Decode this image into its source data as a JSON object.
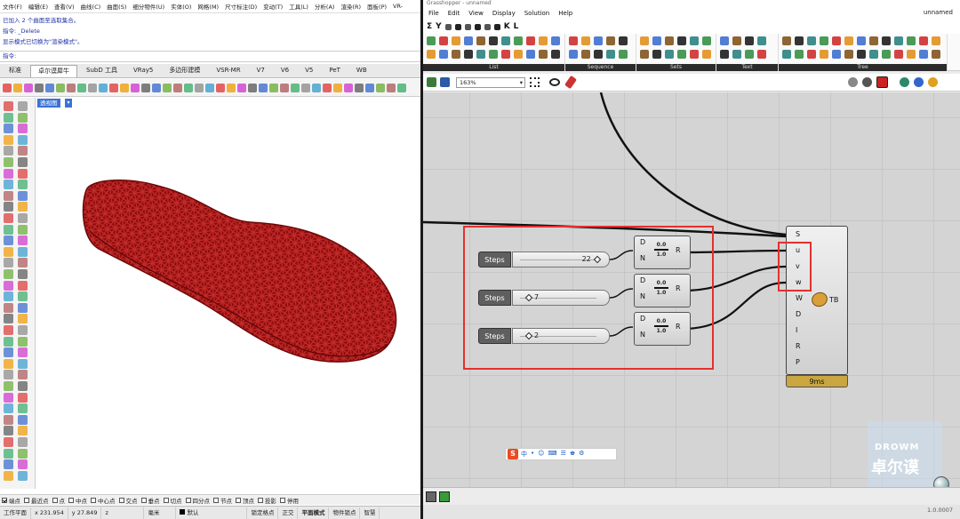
{
  "rhino": {
    "menu": [
      "文件(F)",
      "编辑(E)",
      "查看(V)",
      "曲线(C)",
      "曲面(S)",
      "细分物件(U)",
      "实体(O)",
      "网格(M)",
      "尺寸标注(D)",
      "变动(T)",
      "工具(L)",
      "分析(A)",
      "渲染(R)",
      "面板(P)",
      "VR-"
    ],
    "command_history": [
      "已加入 2 个曲面至选取集合。",
      "指令: _Delete",
      "显示模式已切换为\"渲染模式\"。"
    ],
    "command_prompt": "指令:",
    "tabs": [
      "标准",
      "卓尔谟犀牛",
      "SubD 工具",
      "VRay5",
      "多边形建模",
      "VSR-MR",
      "V7",
      "V6",
      "V5",
      "PeT",
      "WB"
    ],
    "active_tab": "卓尔谟犀牛",
    "viewport_label": "透视图",
    "viewport_arrow": "▾",
    "model_color": "#a01212",
    "osnaps": [
      {
        "label": "端点",
        "on": true
      },
      {
        "label": "最近点",
        "on": false
      },
      {
        "label": "点",
        "on": false
      },
      {
        "label": "中点",
        "on": false
      },
      {
        "label": "中心点",
        "on": false
      },
      {
        "label": "交点",
        "on": false
      },
      {
        "label": "垂点",
        "on": false
      },
      {
        "label": "切点",
        "on": false
      },
      {
        "label": "四分点",
        "on": false
      },
      {
        "label": "节点",
        "on": false
      },
      {
        "label": "顶点",
        "on": false
      },
      {
        "label": "投影",
        "on": false
      },
      {
        "label": "停用",
        "on": false
      }
    ],
    "status": {
      "cplane": "工作平面",
      "x": "x 231.954",
      "y": "y 27.849",
      "z": "z",
      "unit": "毫米",
      "layer": "默认",
      "items": [
        "锁定格点",
        "正交",
        "平面模式",
        "物件锁点",
        "智慧"
      ]
    }
  },
  "grasshopper": {
    "title": "Grasshopper - unnamed",
    "menu": [
      "File",
      "Edit",
      "View",
      "Display",
      "Solution",
      "Help"
    ],
    "doc_name": "unnamed",
    "icon_row": [
      "Σ",
      "Y",
      "K",
      "L"
    ],
    "ribbon_groups": [
      "List",
      "Sequence",
      "Sets",
      "Text",
      "Tree"
    ],
    "zoom": "163%",
    "sliders": [
      {
        "label": "Steps",
        "value": "22",
        "fraction": 0.95
      },
      {
        "label": "Steps",
        "value": "7",
        "fraction": 0.08
      },
      {
        "label": "Steps",
        "value": "2",
        "fraction": 0.08
      }
    ],
    "range_component": {
      "inputs": [
        "D",
        "N"
      ],
      "output": "R",
      "icon_top": "0.0",
      "icon_bottom": "1.0"
    },
    "tb_component": {
      "inputs": [
        "S",
        "u",
        "v",
        "w",
        "W",
        "D",
        "I",
        "R",
        "P"
      ],
      "output": "TB",
      "time": "9ms"
    },
    "ime": {
      "logo": "S",
      "items": [
        "中",
        "•",
        "☺",
        "⌨",
        "☰",
        "♚",
        "⚙"
      ]
    },
    "watermark": {
      "en": "DROWM",
      "cn": "卓尔谟"
    },
    "version": "1.0.0007"
  }
}
